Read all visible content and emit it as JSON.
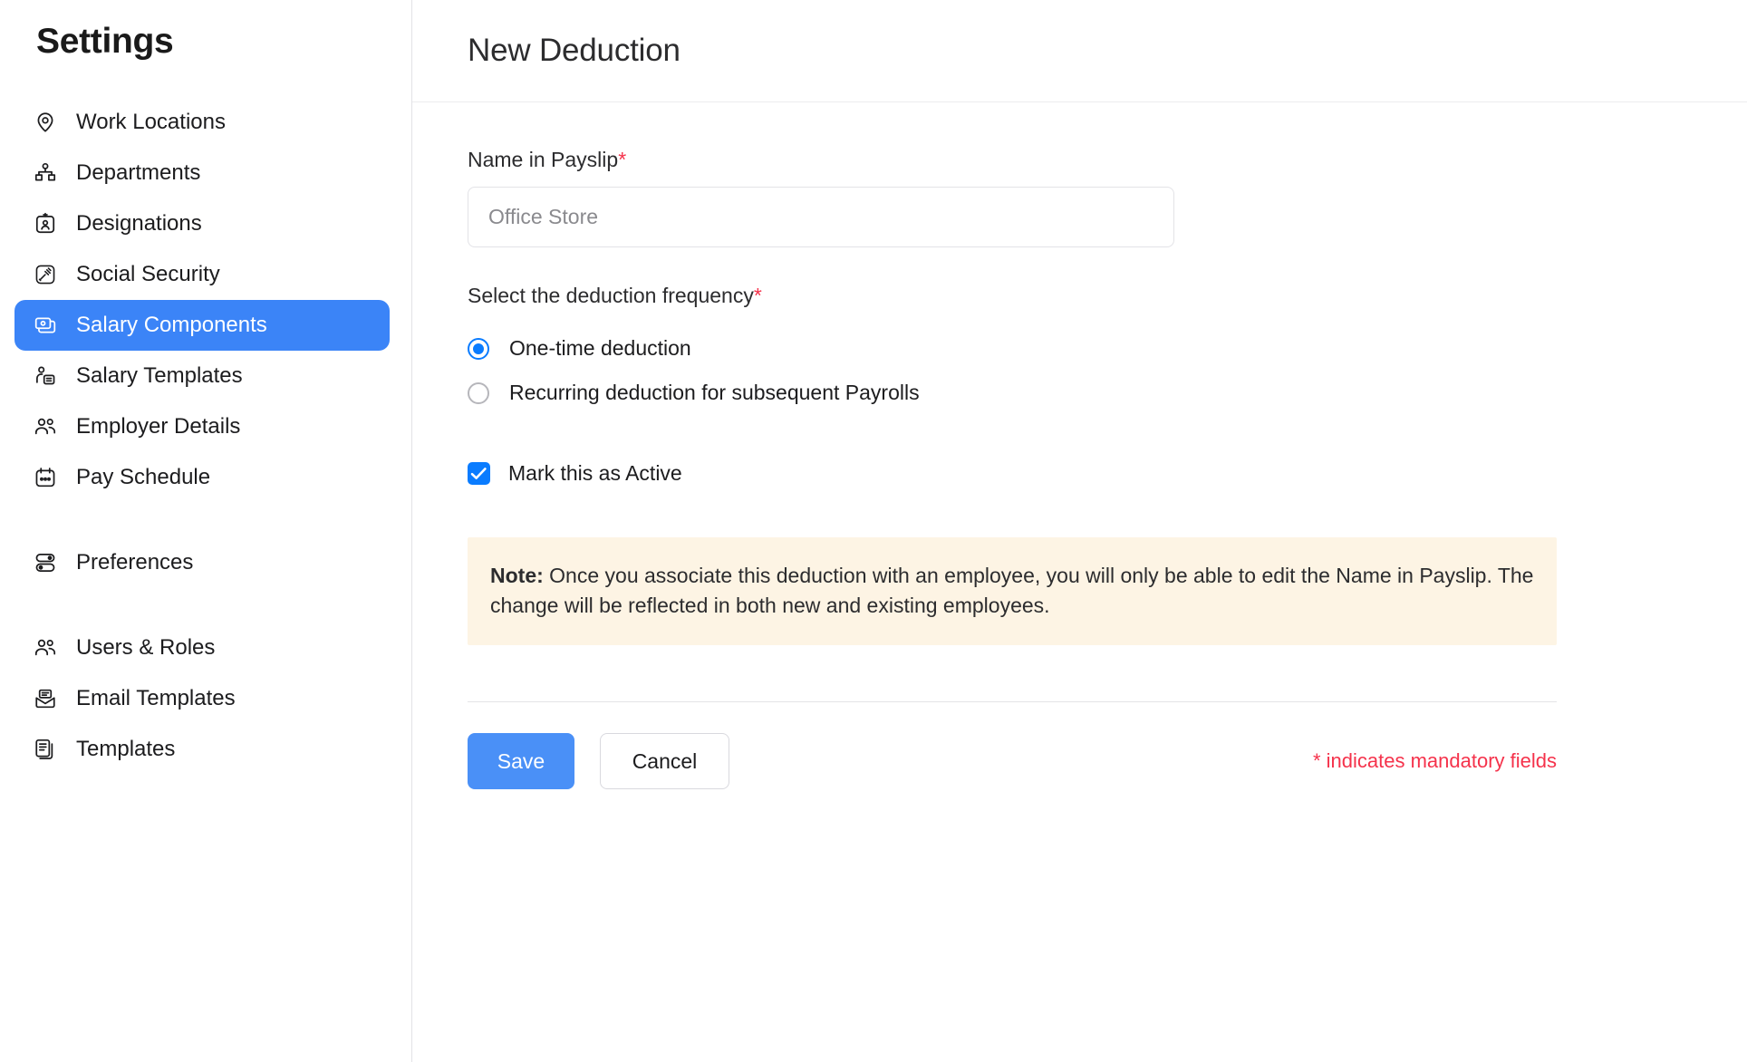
{
  "sidebar": {
    "title": "Settings",
    "items": [
      {
        "label": "Work Locations",
        "icon": "map-pin-icon",
        "active": false
      },
      {
        "label": "Departments",
        "icon": "org-chart-icon",
        "active": false
      },
      {
        "label": "Designations",
        "icon": "id-badge-icon",
        "active": false
      },
      {
        "label": "Social Security",
        "icon": "gavel-icon",
        "active": false
      },
      {
        "label": "Salary Components",
        "icon": "salary-cards-icon",
        "active": true
      },
      {
        "label": "Salary Templates",
        "icon": "person-document-icon",
        "active": false
      },
      {
        "label": "Employer Details",
        "icon": "users-icon",
        "active": false
      },
      {
        "label": "Pay Schedule",
        "icon": "calendar-dots-icon",
        "active": false
      },
      {
        "label": "Preferences",
        "icon": "toggles-icon",
        "active": false
      },
      {
        "label": "Users & Roles",
        "icon": "users-icon",
        "active": false
      },
      {
        "label": "Email Templates",
        "icon": "open-envelope-icon",
        "active": false
      },
      {
        "label": "Templates",
        "icon": "documents-icon",
        "active": false
      }
    ]
  },
  "header": {
    "title": "New Deduction"
  },
  "form": {
    "name_label": "Name in Payslip",
    "name_required_mark": "*",
    "name_value": "",
    "name_placeholder": "Office Store",
    "frequency_label": "Select the deduction frequency",
    "frequency_required_mark": "*",
    "frequency_options": [
      {
        "label": "One-time deduction",
        "selected": true
      },
      {
        "label": "Recurring deduction for subsequent Payrolls",
        "selected": false
      }
    ],
    "active_checkbox_label": "Mark this as Active",
    "active_checkbox_checked": true,
    "note_prefix": "Note:",
    "note_body": " Once you associate this deduction with an employee, you will only be able to edit the Name in Payslip. The change will be reflected in both new and existing employees.",
    "save_label": "Save",
    "cancel_label": "Cancel",
    "mandatory_note": "* indicates mandatory fields"
  },
  "colors": {
    "accent_blue": "#3b84f7",
    "control_blue": "#0a7cff",
    "save_blue": "#4a90f7",
    "required_red": "#f5324b",
    "note_bg": "#fdf4e4"
  }
}
